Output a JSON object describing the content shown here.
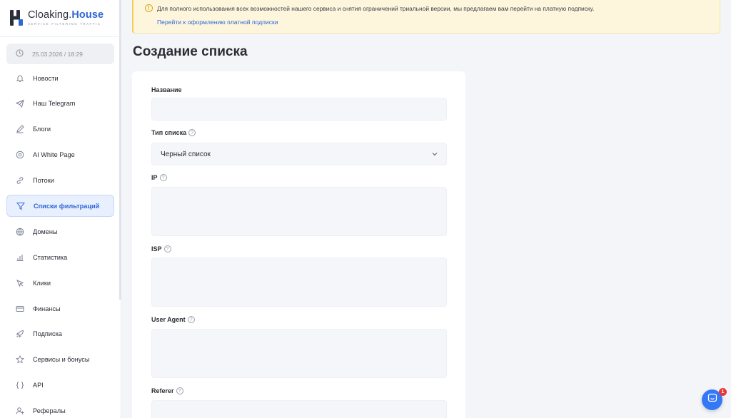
{
  "brand": {
    "name_part1": "Cloaking.",
    "name_part2": "House",
    "tagline": "SERVICE FILTERING TRAFFIC"
  },
  "sidebar": {
    "datetime": "25.03.2026 / 18:29",
    "items": [
      {
        "label": "Новости",
        "icon": "bell-icon"
      },
      {
        "label": "Наш Telegram",
        "icon": "telegram-icon"
      },
      {
        "label": "Блоги",
        "icon": "pen-icon"
      },
      {
        "label": "AI White Page",
        "icon": "ai-icon"
      },
      {
        "label": "Потоки",
        "icon": "link-icon"
      },
      {
        "label": "Списки фильтраций",
        "icon": "filter-icon",
        "active": true
      },
      {
        "label": "Домены",
        "icon": "globe-icon"
      },
      {
        "label": "Статистика",
        "icon": "chart-icon"
      },
      {
        "label": "Клики",
        "icon": "cursor-icon"
      },
      {
        "label": "Финансы",
        "icon": "card-icon"
      },
      {
        "label": "Подписка",
        "icon": "rocket-icon"
      },
      {
        "label": "Сервисы и бонусы",
        "icon": "star-icon"
      },
      {
        "label": "API",
        "icon": "braces-icon"
      },
      {
        "label": "Рефералы",
        "icon": "user-plus-icon"
      }
    ]
  },
  "banner": {
    "message": "Для полного использования всех возможностей нашего сервиса и снятия ограничений триальной версии, мы предлагаем вам перейти на платную подписку.",
    "link": "Перейти к оформлению платной подписки"
  },
  "page": {
    "title": "Создание списка"
  },
  "form": {
    "name_label": "Название",
    "name_value": "",
    "type_label": "Тип списка",
    "type_value": "Черный список",
    "ip_label": "IP",
    "isp_label": "ISP",
    "ua_label": "User Agent",
    "referer_label": "Referer"
  },
  "chat": {
    "badge_count": "1"
  },
  "colors": {
    "accent": "#2f66d6",
    "warning_bg": "#fdf6dd",
    "badge": "#e6373d"
  }
}
